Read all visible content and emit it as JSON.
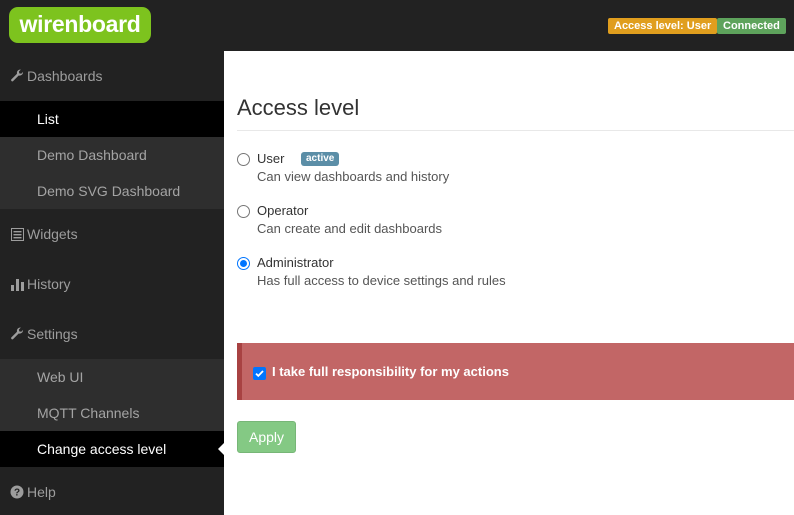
{
  "header": {
    "logo_text": "wirenboard",
    "access_badge": "Access level: User",
    "connection_badge": "Connected",
    "colors": {
      "brand": "#7dc31e",
      "access": "#e09e1e",
      "connected": "#5ea35c"
    }
  },
  "sidebar": {
    "dashboards": {
      "label": "Dashboards",
      "icon": "wrench-icon",
      "items": [
        {
          "label": "List"
        },
        {
          "label": "Demo Dashboard"
        },
        {
          "label": "Demo SVG Dashboard"
        }
      ]
    },
    "widgets": {
      "label": "Widgets",
      "icon": "list-icon"
    },
    "history": {
      "label": "History",
      "icon": "bar-chart-icon"
    },
    "settings": {
      "label": "Settings",
      "icon": "wrench-icon",
      "items": [
        {
          "label": "Web UI"
        },
        {
          "label": "MQTT Channels"
        },
        {
          "label": "Change access level"
        }
      ]
    },
    "help": {
      "label": "Help",
      "icon": "question-circle-icon"
    }
  },
  "main": {
    "title": "Access level",
    "options": [
      {
        "name": "User",
        "badge": "active",
        "description": "Can view dashboards and history",
        "checked": false
      },
      {
        "name": "Operator",
        "description": "Can create and edit dashboards",
        "checked": false
      },
      {
        "name": "Administrator",
        "description": "Has full access to device settings and rules",
        "checked": true
      }
    ],
    "confirm_label": "I take full responsibility for my actions",
    "apply_label": "Apply"
  }
}
